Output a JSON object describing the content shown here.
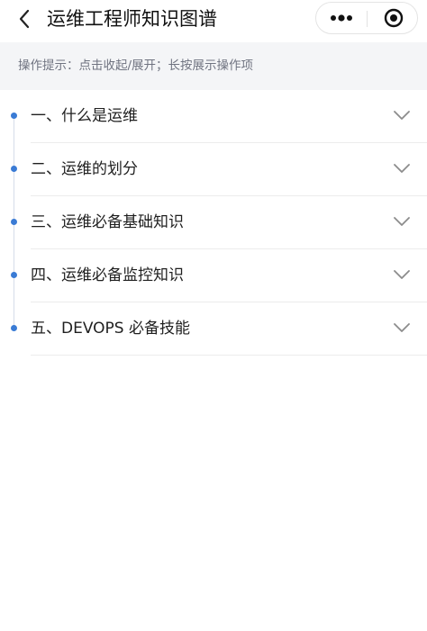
{
  "header": {
    "title": "运维工程师知识图谱",
    "back_icon": "back-chevron-icon",
    "more_icon": "more-dots-icon",
    "close_icon": "target-close-icon"
  },
  "hint": {
    "text": "操作提示：点击收起/展开；长按展示操作项"
  },
  "tree": {
    "accent_color": "#3a7bd5",
    "items": [
      {
        "label": "一、什么是运维",
        "expanded": false
      },
      {
        "label": "二、运维的划分",
        "expanded": false
      },
      {
        "label": "三、运维必备基础知识",
        "expanded": false
      },
      {
        "label": "四、运维必备监控知识",
        "expanded": false
      },
      {
        "label": "五、DEVOPS 必备技能",
        "expanded": false
      }
    ]
  }
}
